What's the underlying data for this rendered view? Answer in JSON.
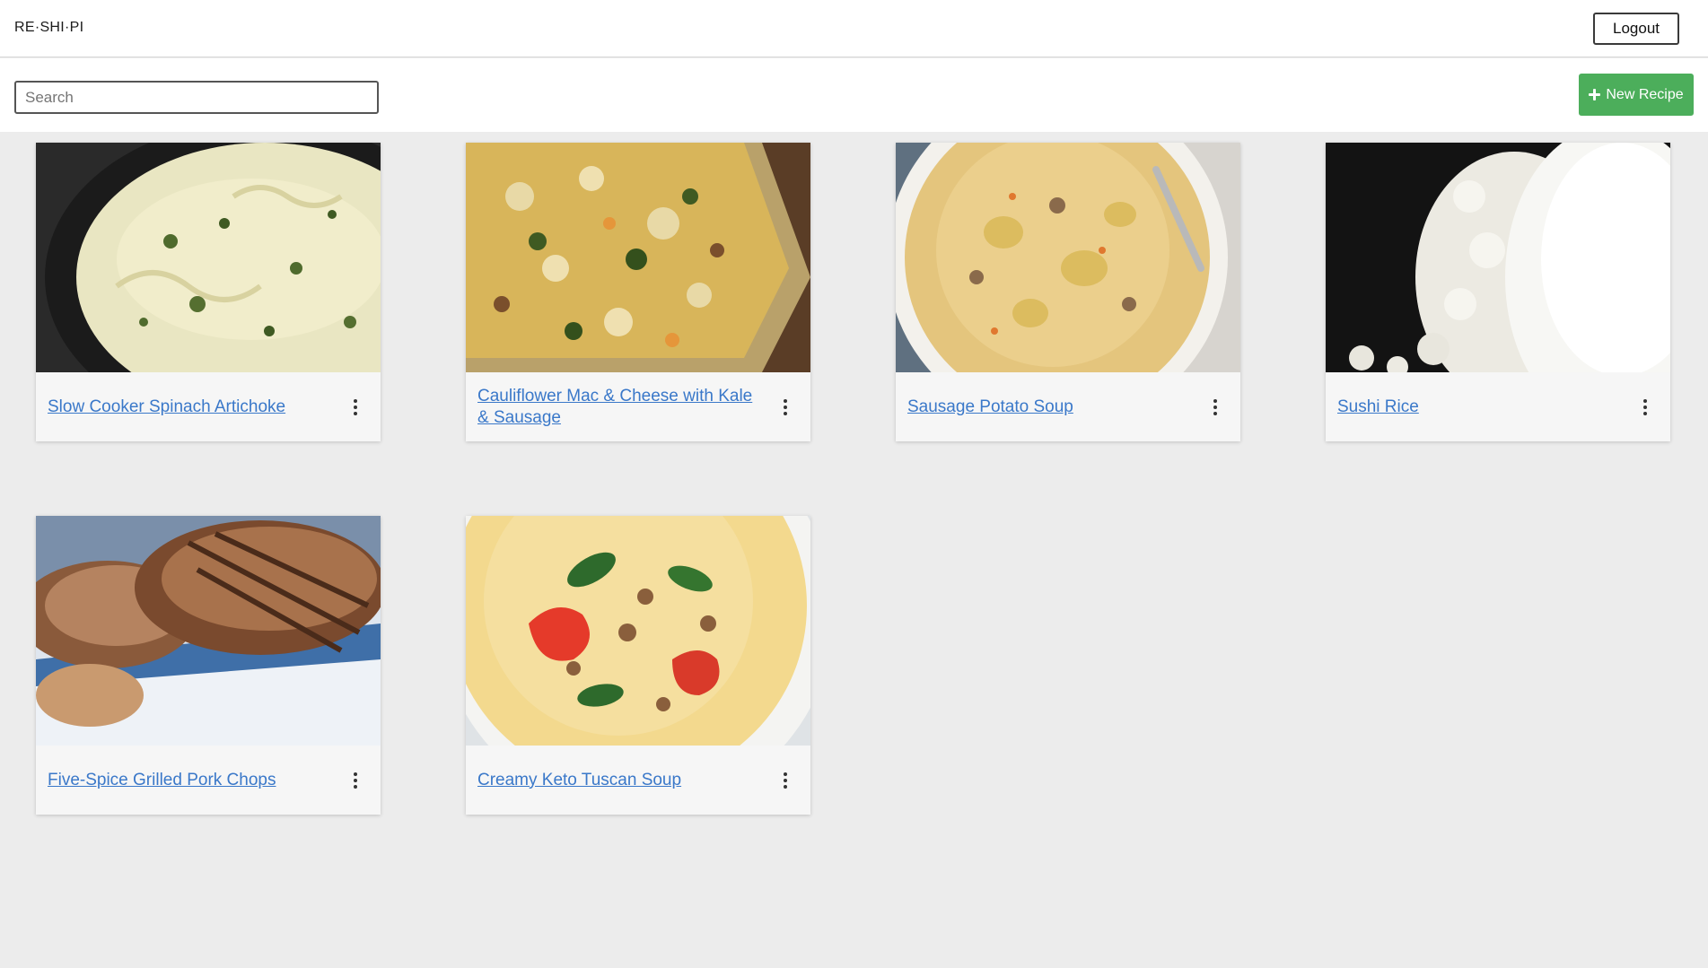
{
  "app": {
    "brand": "RE·SHI·PI",
    "logout_label": "Logout"
  },
  "toolbar": {
    "search_placeholder": "Search",
    "search_value": "",
    "new_recipe_label": "New Recipe",
    "new_recipe_icon": "plus-icon"
  },
  "colors": {
    "accent_green": "#4cae5b",
    "link_blue": "#3a78c9",
    "page_background": "#ececec"
  },
  "recipes": [
    {
      "title": "Slow Cooker Spinach Artichoke",
      "image": "spinach-artichoke-dip-photo"
    },
    {
      "title": "Cauliflower Mac & Cheese with Kale & Sausage",
      "image": "cauliflower-mac-casserole-photo"
    },
    {
      "title": "Sausage Potato Soup",
      "image": "sausage-potato-soup-photo"
    },
    {
      "title": "Sushi Rice",
      "image": "sushi-rice-photo"
    },
    {
      "title": "Five-Spice Grilled Pork Chops",
      "image": "grilled-pork-chops-photo"
    },
    {
      "title": "Creamy Keto Tuscan Soup",
      "image": "tuscan-soup-photo"
    }
  ]
}
